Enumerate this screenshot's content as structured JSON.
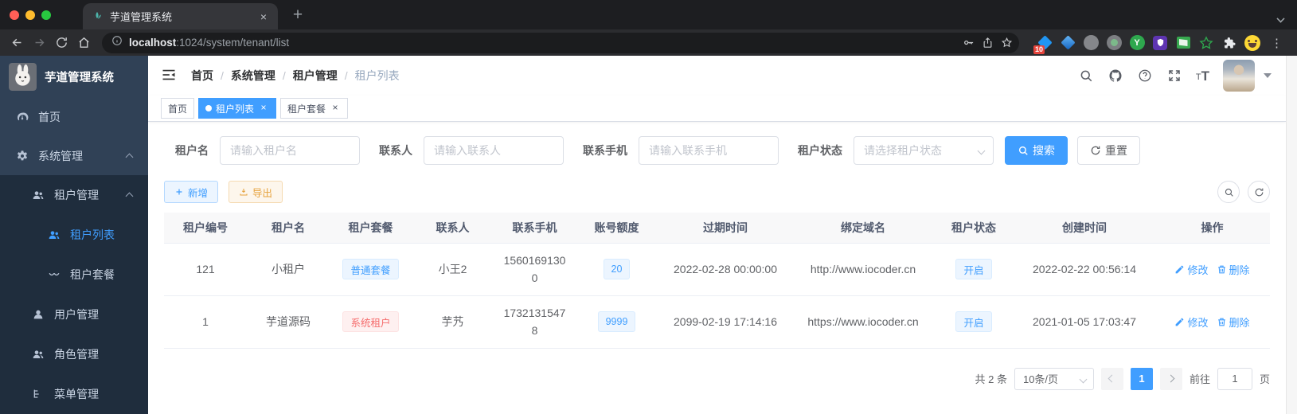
{
  "browser": {
    "tab_title": "芋道管理系统",
    "url": {
      "host": "localhost",
      "path": ":1024/system/tenant/list"
    },
    "extension_badge": "10"
  },
  "sidebar": {
    "logo_title": "芋道管理系统",
    "menu": {
      "home": "首页",
      "system": "系统管理",
      "tenant": "租户管理",
      "tenant_list": "租户列表",
      "tenant_package": "租户套餐",
      "user": "用户管理",
      "role": "角色管理",
      "menu_mgmt": "菜单管理"
    }
  },
  "header": {
    "breadcrumb": [
      "首页",
      "系统管理",
      "租户管理",
      "租户列表"
    ]
  },
  "tags": [
    {
      "label": "首页"
    },
    {
      "label": "租户列表"
    },
    {
      "label": "租户套餐"
    }
  ],
  "filters": {
    "tenant_name": {
      "label": "租户名",
      "placeholder": "请输入租户名"
    },
    "contact": {
      "label": "联系人",
      "placeholder": "请输入联系人"
    },
    "mobile": {
      "label": "联系手机",
      "placeholder": "请输入联系手机"
    },
    "status": {
      "label": "租户状态",
      "placeholder": "请选择租户状态"
    },
    "search_label": "搜索",
    "reset_label": "重置"
  },
  "toolbar": {
    "add_label": "新增",
    "export_label": "导出"
  },
  "table": {
    "columns": [
      "租户编号",
      "租户名",
      "租户套餐",
      "联系人",
      "联系手机",
      "账号额度",
      "过期时间",
      "绑定域名",
      "租户状态",
      "创建时间",
      "操作"
    ],
    "rows": [
      {
        "id": "121",
        "name": "小租户",
        "package": "普通套餐",
        "contact": "小王2",
        "mobile": "15601691300",
        "quota": "20",
        "expire": "2022-02-28 00:00:00",
        "domain": "http://www.iocoder.cn",
        "status": "开启",
        "created": "2022-02-22 00:56:14"
      },
      {
        "id": "1",
        "name": "芋道源码",
        "package": "系统租户",
        "contact": "芋艿",
        "mobile": "17321315478",
        "quota": "9999",
        "expire": "2099-02-19 17:14:16",
        "domain": "https://www.iocoder.cn",
        "status": "开启",
        "created": "2021-01-05 17:03:47"
      }
    ],
    "edit_label": "修改",
    "delete_label": "删除"
  },
  "pagination": {
    "total": "共 2 条",
    "page_size": "10条/页",
    "page": "1",
    "goto_label": "前往",
    "goto_value": "1",
    "unit_label": "页"
  },
  "colors": {
    "primary": "#409eff",
    "danger": "#f56c6c",
    "warning": "#e6a23c"
  }
}
